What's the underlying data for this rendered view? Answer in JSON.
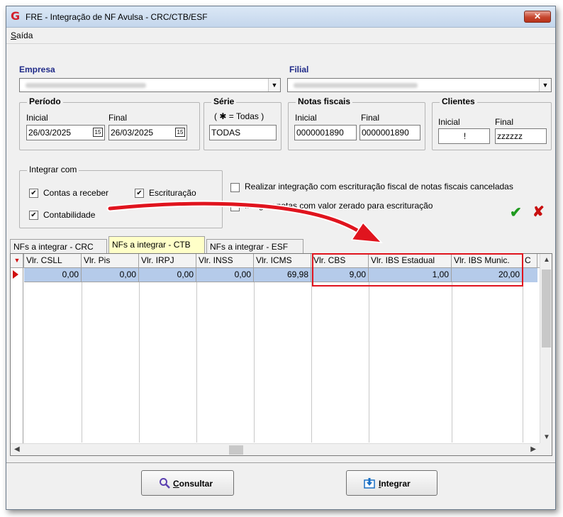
{
  "window": {
    "title": "FRE - Integração de NF Avulsa - CRC/CTB/ESF",
    "close": "✕"
  },
  "menu": {
    "saida_first": "S",
    "saida_rest": "aída"
  },
  "empresa": {
    "label": "Empresa"
  },
  "filial": {
    "label": "Filial"
  },
  "periodo": {
    "title": "Período",
    "inicial_label": "Inicial",
    "final_label": "Final",
    "inicial": "26/03/2025",
    "final": "26/03/2025"
  },
  "serie": {
    "title": "Série",
    "hint": "( ✱ = Todas )",
    "value": "TODAS"
  },
  "notas": {
    "title": "Notas fiscais",
    "inicial_label": "Inicial",
    "final_label": "Final",
    "inicial": "0000001890",
    "final": "0000001890"
  },
  "clientes": {
    "title": "Clientes",
    "inicial_label": "Inicial",
    "final_label": "Final",
    "inicial": "!",
    "final": "zzzzzz"
  },
  "integrar": {
    "title": "Integrar com",
    "contas": "Contas a receber",
    "escrituracao": "Escrituração",
    "contabilidade": "Contabilidade"
  },
  "options": {
    "canceladas": "Realizar integração com escrituração fiscal de notas fiscais canceladas",
    "zerado": "Integrar notas com valor zerado para escrituração"
  },
  "tabs": [
    "NFs a integrar - CRC",
    "NFs a integrar - CTB",
    "NFs a integrar - ESF"
  ],
  "grid": {
    "headers": [
      "Vlr. CSLL",
      "Vlr. Pis",
      "Vlr. IRPJ",
      "Vlr. INSS",
      "Vlr. ICMS",
      "Vlr. CBS",
      "Vlr. IBS Estadual",
      "Vlr. IBS Munic.",
      "C"
    ],
    "row": [
      "0,00",
      "0,00",
      "0,00",
      "0,00",
      "69,98",
      "9,00",
      "1,00",
      "20,00"
    ]
  },
  "buttons": {
    "consultar_first": "C",
    "consultar_rest": "onsultar",
    "integrar_first": "I",
    "integrar_rest": "ntegrar"
  },
  "colors": {
    "accent": "#1f2a88",
    "highlight": "#e0141e",
    "selected_row": "#b5cbea",
    "active_tab": "#ffffc8"
  }
}
